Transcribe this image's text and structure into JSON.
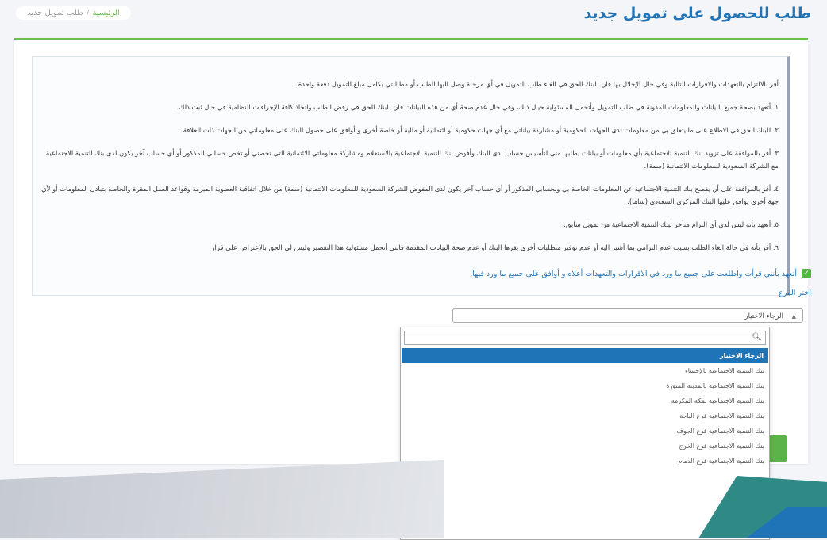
{
  "header": {
    "title": "طلب للحصول على تمويل جديد",
    "breadcrumb": {
      "home": "الرئيسية",
      "separator": "/",
      "current": "طلب تمويل جديد"
    }
  },
  "terms": {
    "intro": "أقر بالالتزام بالتعهدات والاقرارات التالية وفي حال الإخلال بها فان للبنك الحق في الغاء طلب التمويل في أي مرحلة وصل اليها الطلب أو مطالبتي بكامل مبلغ التمويل دفعة واحدة.",
    "items": [
      "١. أتعهد بصحة جميع البيانات والمعلومات المدونة في طلب التمويل وأتحمل المسئولية حيال ذلك، وفي حال عدم صحة أي من هذه البيانات فان للبنك الحق في رفض الطلب واتخاذ كافة الإجراءات النظامية في حال ثبت ذلك.",
      "٢. للبنك الحق في الاطلاع على ما يتعلق بي من معلومات لدى الجهات الحكومية أو مشاركة بياناتي مع أي جهات حكومية أو ائتمانية أو مالية أو خاصة أخرى و أوافق على حصول البنك على معلوماتي من الجهات ذات العلاقة.",
      "٣. أقر بالموافقة على تزويد بنك التنمية الاجتماعية بأي معلومات أو بيانات يطلبها مني لتأسيس حساب لدى البنك وأفوض بنك التنمية الاجتماعية بالاستعلام ومشاركة معلوماتي الائتمانية التي تخصني أو تخص حسابي المذكور أو أي حساب آخر يكون لدى بنك التنمية الاجتماعية مع الشركة السعودية للمعلومات الائتمانية (سمة).",
      "٤. أقر بالموافقة على أن يفصح بنك التنمية الاجتماعية عن المعلومات الخاصة بي وبحسابي المذكور أو أي حساب آخر يكون لدى المفوض للشركة السعودية للمعلومات الائتمانية (سمة) من خلال اتفاقية العضوية المبرمة وقواعد العمل المقرة والخاصة بتبادل المعلومات أو لأي جهة أخرى يوافق عليها البنك المركزي السعودي (ساما).",
      "٥. أتعهد بأنه ليس لدي أي التزام متأخر لبنك التنمية الاجتماعية من تمويل سابق.",
      "٦. أقر بأنه في حالة الغاء الطلب بسبب عدم التزامي بما أشير اليه أو عدم توفير متطلبات أخرى يقرها البنك أو عدم صحة البيانات المقدمة فانني أتحمل مسئولية هذا التقصير وليس لي الحق بالاعتراض على قرار"
    ]
  },
  "agreement": {
    "checked": true,
    "label": "أتعهد بأنني قرأت واطلعت على جميع ما ورد في الاقرارات والتعهدات أعلاه و أوافق على جميع ما ورد فيها."
  },
  "branch": {
    "label": "اختر الفرع",
    "placeholder": "الرجاء الاختيار",
    "options": [
      "الرجاء الاختيار",
      "بنك التنمية الاجتماعية بالإحساء",
      "بنك التنمية الاجتماعية بالمدينة المنورة",
      "بنك التنمية الاجتماعية بمكة المكرمة",
      "بنك التنمية الاجتماعية فرع الباحة",
      "بنك التنمية الاجتماعية فرع الجوف",
      "بنك التنمية الاجتماعية فرع الخرج",
      "بنك التنمية الاجتماعية فرع الدمام"
    ],
    "selected_index": 0
  },
  "icons": {
    "checkbox": "check-icon",
    "select_arrow": "chevron-down-icon",
    "search": "search-icon"
  },
  "colors": {
    "primary": "#1f73b7",
    "accent": "#6cc049",
    "selected_bg": "#1f73b7"
  }
}
